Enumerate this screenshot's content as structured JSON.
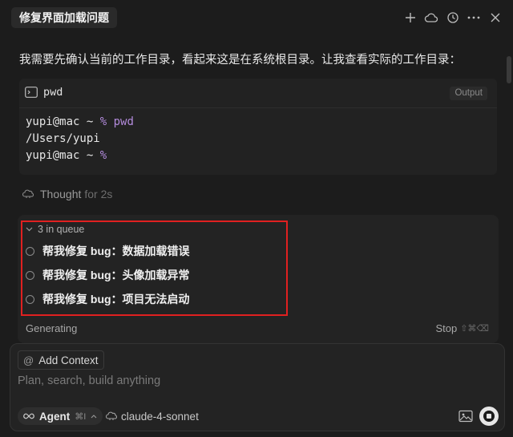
{
  "header": {
    "title": "修复界面加载问题",
    "icons": [
      "plus-icon",
      "cloud-icon",
      "history-icon",
      "more-icon",
      "close-icon"
    ]
  },
  "message": {
    "text": "我需要先确认当前的工作目录，看起来这是在系统根目录。让我查看实际的工作目录："
  },
  "terminal": {
    "command": "pwd",
    "badge": "Output",
    "lines": [
      {
        "prefix": "yupi@mac ~ ",
        "symbol": "%",
        "rest": " pwd"
      },
      {
        "prefix": "/Users/yupi",
        "symbol": "",
        "rest": ""
      },
      {
        "prefix": "yupi@mac ~ ",
        "symbol": "%",
        "rest": ""
      }
    ]
  },
  "thought": {
    "label": "Thought",
    "duration": "for 2s"
  },
  "queue": {
    "header": "3 in queue",
    "items": [
      "帮我修复 bug：数据加载错误",
      "帮我修复 bug：头像加载异常",
      "帮我修复 bug：项目无法启动"
    ],
    "status": "Generating",
    "stop_label": "Stop",
    "stop_shortcut": "⇧⌘⌫"
  },
  "composer": {
    "add_context_label": "Add Context",
    "placeholder": "Plan, search, build anything",
    "agent_label": "Agent",
    "agent_shortcut": "⌘I",
    "model_label": "claude-4-sonnet"
  },
  "colors": {
    "background": "#1c1c1c",
    "panel": "#232323",
    "highlight_border": "#e02020",
    "prompt_symbol": "#b38bdc"
  }
}
